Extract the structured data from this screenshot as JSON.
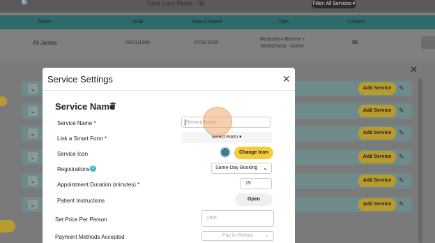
{
  "background": {
    "total_text": "Total Care Plans - 46",
    "filter_label": "Filter: All Services",
    "columns": [
      "Name",
      "DOB",
      "Date Created",
      "Type",
      "Contact"
    ],
    "row": {
      "name": "Ali James",
      "dob": "06/01/1999",
      "date_created": "07/01/2025",
      "type_line1": "Medication Review +",
      "type_line2": "MedsCheck - Active"
    },
    "add_service_label": "Add Service"
  },
  "modal": {
    "title": "Service Settings",
    "service_name_heading": "Service Name",
    "fields": {
      "service_name_label": "Service Name *",
      "service_name_placeholder": "Service Name",
      "smart_form_label": "Link a Smart Form *",
      "smart_form_value": "Select Form",
      "service_icon_label": "Service Icon",
      "change_icon_label": "Change Icon",
      "registrations_label": "Registrations",
      "registrations_value": "Same-Day Booking",
      "duration_label": "Appointment Duration (minutes) *",
      "duration_value": "15",
      "instructions_label": "Patient Instructions",
      "open_label": "Open",
      "price_label": "Set Price Per Person",
      "price_placeholder": "OFF",
      "payment_label": "Payment Methods Accepted",
      "payment_value": "Pay In-Person"
    }
  },
  "colors": {
    "accent_yellow": "#f4cc3a",
    "teal_header": "#2e6a6b",
    "info_blue": "#4fb4c4",
    "cursor_highlight": "#f4aa6e"
  }
}
